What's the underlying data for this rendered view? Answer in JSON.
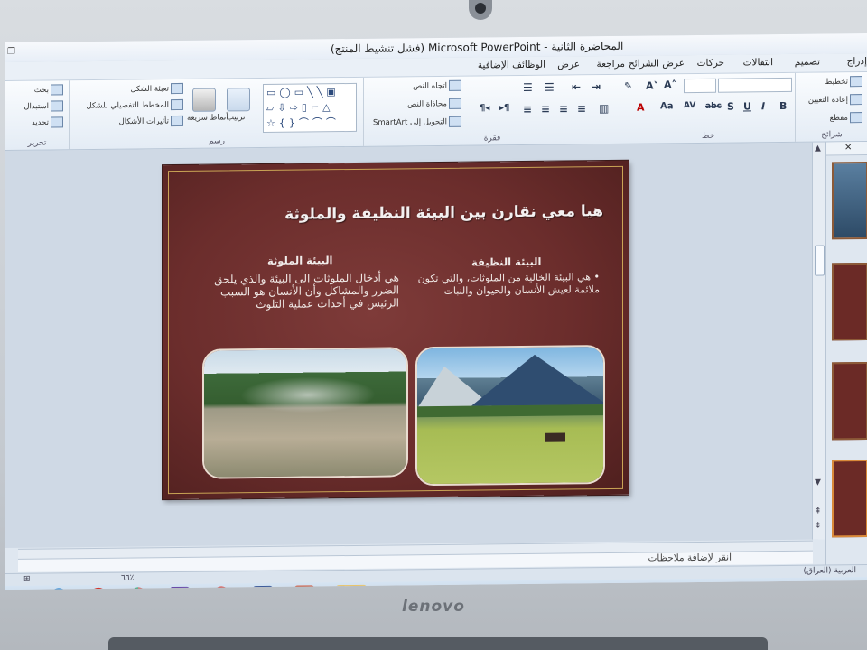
{
  "window": {
    "title": "المحاضرة الثانية - Microsoft PowerPoint (فشل تنشيط المنتج)"
  },
  "tabs": [
    "إدراج",
    "تصميم",
    "انتقالات",
    "حركات",
    "عرض الشرائح",
    "مراجعة",
    "عرض",
    "الوظائف الإضافية"
  ],
  "ribbon": {
    "slides_group": {
      "label": "شرائح",
      "layout": "تخطيط",
      "reset": "إعادة التعيين",
      "section": "مقطع"
    },
    "font_group": {
      "label": "خط"
    },
    "paragraph_group": {
      "label": "فقرة",
      "text_direction": "اتجاه النص",
      "align_text": "محاذاة النص",
      "convert_smartart": "التحويل إلى SmartArt"
    },
    "drawing_group": {
      "label": "رسم",
      "arrange": "ترتيب",
      "quick_styles": "أنماط سريعة",
      "shape_fill": "تعبئة الشكل",
      "shape_outline": "المخطط التفصيلي للشكل",
      "shape_effects": "تأثيرات الأشكال"
    },
    "editing_group": {
      "label": "تحرير",
      "find": "بحث",
      "replace": "استبدال",
      "select": "تحديد"
    }
  },
  "slide": {
    "title": "هيا معي نقارن بين البيئة النظيفة والملوثة",
    "clean": {
      "heading": "البيئة النظيفة",
      "body": "هي البيئة الخالية من الملوثات، والتي تكون ملائمة لعيش الأنسان والحيوان والنبات"
    },
    "polluted": {
      "heading": "البيئة الملوثة",
      "body": "هي أدخال الملوثات الى البيئة والذي يلحق الضرر والمشاكل وأن الأنسان هو السبب الرئيس في أحداث عملية التلوث"
    }
  },
  "notes": {
    "placeholder": "انقر لإضافة ملاحظات"
  },
  "status": {
    "language": "العربية (العراق)",
    "zoom": "٦٦٪"
  },
  "bezel": {
    "brand": "lenovo"
  }
}
